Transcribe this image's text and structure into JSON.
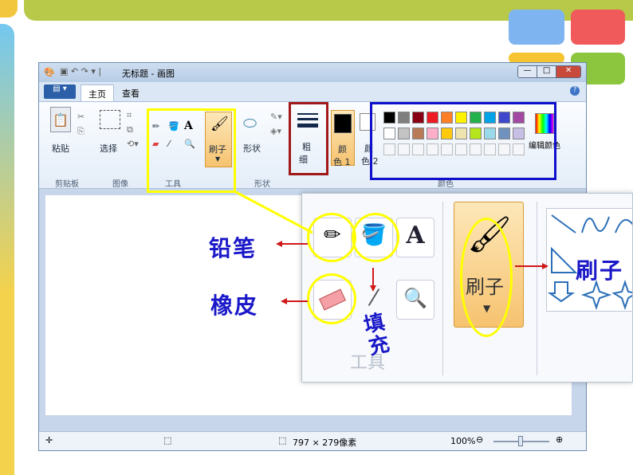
{
  "window": {
    "title": "无标题 - 画图",
    "tabs": [
      "主页",
      "查看"
    ],
    "groups": {
      "clipboard": {
        "label": "剪贴板",
        "paste": "粘贴"
      },
      "image": {
        "label": "图像",
        "select": "选择"
      },
      "tools": {
        "label": "工具"
      },
      "brushes": {
        "label": "刷子"
      },
      "shapes": {
        "label": "形状",
        "shapes_btn": "形状"
      },
      "size": {
        "line1": "粗",
        "line2": "细"
      },
      "color1": {
        "line1": "颜",
        "line2": "色 1"
      },
      "color2": {
        "line1": "颜",
        "line2": "色 2"
      },
      "colors": {
        "label": "颜色",
        "edit": "编辑颜色"
      }
    },
    "status": {
      "size": "797 × 279像素",
      "zoom": "100%"
    }
  },
  "palette": {
    "row1": [
      "#000000",
      "#7f7f7f",
      "#880015",
      "#ed1c24",
      "#ff7f27",
      "#fff200",
      "#22b14c",
      "#00a2e8",
      "#3f48cc",
      "#a349a4"
    ],
    "row2": [
      "#ffffff",
      "#c3c3c3",
      "#b97a57",
      "#ffaec9",
      "#ffc90e",
      "#efe4b0",
      "#b5e61d",
      "#99d9ea",
      "#7092be",
      "#c8bfe7"
    ]
  },
  "zoom_panel": {
    "group_label": "工具",
    "brush_label": "刷子"
  },
  "annotations": {
    "pencil": "铅笔",
    "eraser": "橡皮",
    "fill": "填充",
    "brush": "刷子"
  },
  "colors": {
    "highlight_yellow": "#ffff00",
    "highlight_red": "#a01818",
    "highlight_blue": "#1010cc",
    "annotation_text": "#1a18c8"
  }
}
